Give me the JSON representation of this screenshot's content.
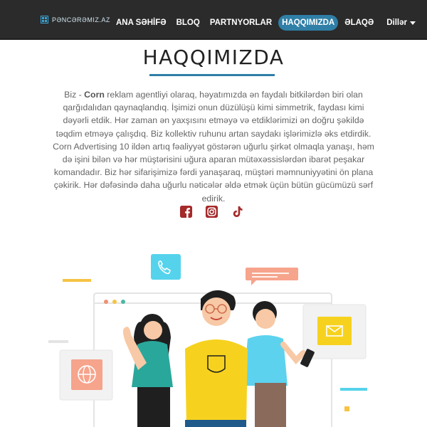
{
  "brand": {
    "name": "PƏNCƏRƏMIZ.AZ"
  },
  "nav": {
    "items": [
      "ANA SƏHİFƏ",
      "BLOQ",
      "PARTNYORLAR",
      "HAQQIMIZDA",
      "ƏLAQƏ"
    ],
    "active": "HAQQIMIZDA",
    "languages_label": "Dillər"
  },
  "page": {
    "title": "HAQQIMIZDA",
    "intro_prefix": "Biz - ",
    "intro_brand": "Corn",
    "intro_body": " reklam agentliyi olaraq, həyatımızda ən faydalı bitkilərdən biri olan qarğıdalıdan qaynaqlandıq. İşimizi onun düzülüşü kimi simmetrik, faydası kimi dəyərli etdik. Hər zaman ən yaxşısını etməyə və etdiklərimizi ən doğru şəkildə təqdim etməyə çalışdıq. Biz kollektiv ruhunu artan saydakı işlərimizlə əks etdirdik. Corn Advertising 10 ildən artıq fəaliyyət göstərən uğurlu şirkət olmaqla yanaşı, həm də işini bilən və hər müştərisini uğura aparan mütəxəssislərdən ibarət peşakar komandadır. Biz hər sifarişimizə fərdi yanaşaraq, müştəri məmnuniyyətini ön plana çəkirik. Hər dəfəsində daha uğurlu nəticələr əldə etmək üçün bütün gücümüzü sərf edirik."
  },
  "social": {
    "icons": [
      "facebook-icon",
      "instagram-icon",
      "tiktok-icon"
    ],
    "color": "#a52a2a"
  },
  "colors": {
    "navbar_bg": "#2b2b2b",
    "accent": "#2f7fa7",
    "social": "#a52a2a"
  }
}
